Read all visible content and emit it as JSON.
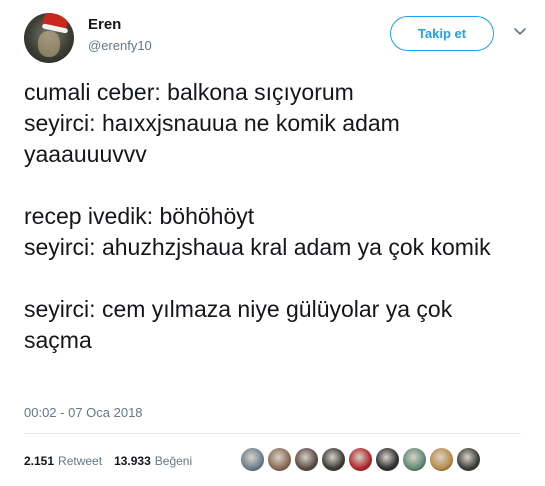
{
  "author": {
    "name": "Eren",
    "handle": "@erenfy10",
    "follow_label": "Takip et"
  },
  "icons": {
    "avatar": "profile-photo-santa-hat",
    "menu": "chevron-down-icon"
  },
  "tweet": {
    "text": "cumali ceber: balkona sıçıyorum\nseyirci: haıxxjsnauua ne komik adam yaaauuuvvv\n\nrecep ivedik: böhöhöyt\nseyirci: ahuzhzjshaua kral adam ya çok komik\n\nseyirci: cem yılmaza niye gülüyolar ya çok saçma",
    "timestamp": "00:02 - 07 Oca 2018"
  },
  "stats": {
    "retweet_count": "2.151",
    "retweet_label": "Retweet",
    "like_count": "13.933",
    "like_label": "Beğeni"
  },
  "colors": {
    "accent": "#1da1f2",
    "text": "#14171a",
    "muted": "#657786",
    "divider": "#e6ecf0"
  },
  "likers": [
    {
      "color": "#6d7f8e"
    },
    {
      "color": "#8a6a55"
    },
    {
      "color": "#5a4a45"
    },
    {
      "color": "#3a3a36"
    },
    {
      "color": "#b3262a"
    },
    {
      "color": "#2f2f30"
    },
    {
      "color": "#5f8a77"
    },
    {
      "color": "#b88b4a"
    },
    {
      "color": "#3b3d3a"
    }
  ]
}
